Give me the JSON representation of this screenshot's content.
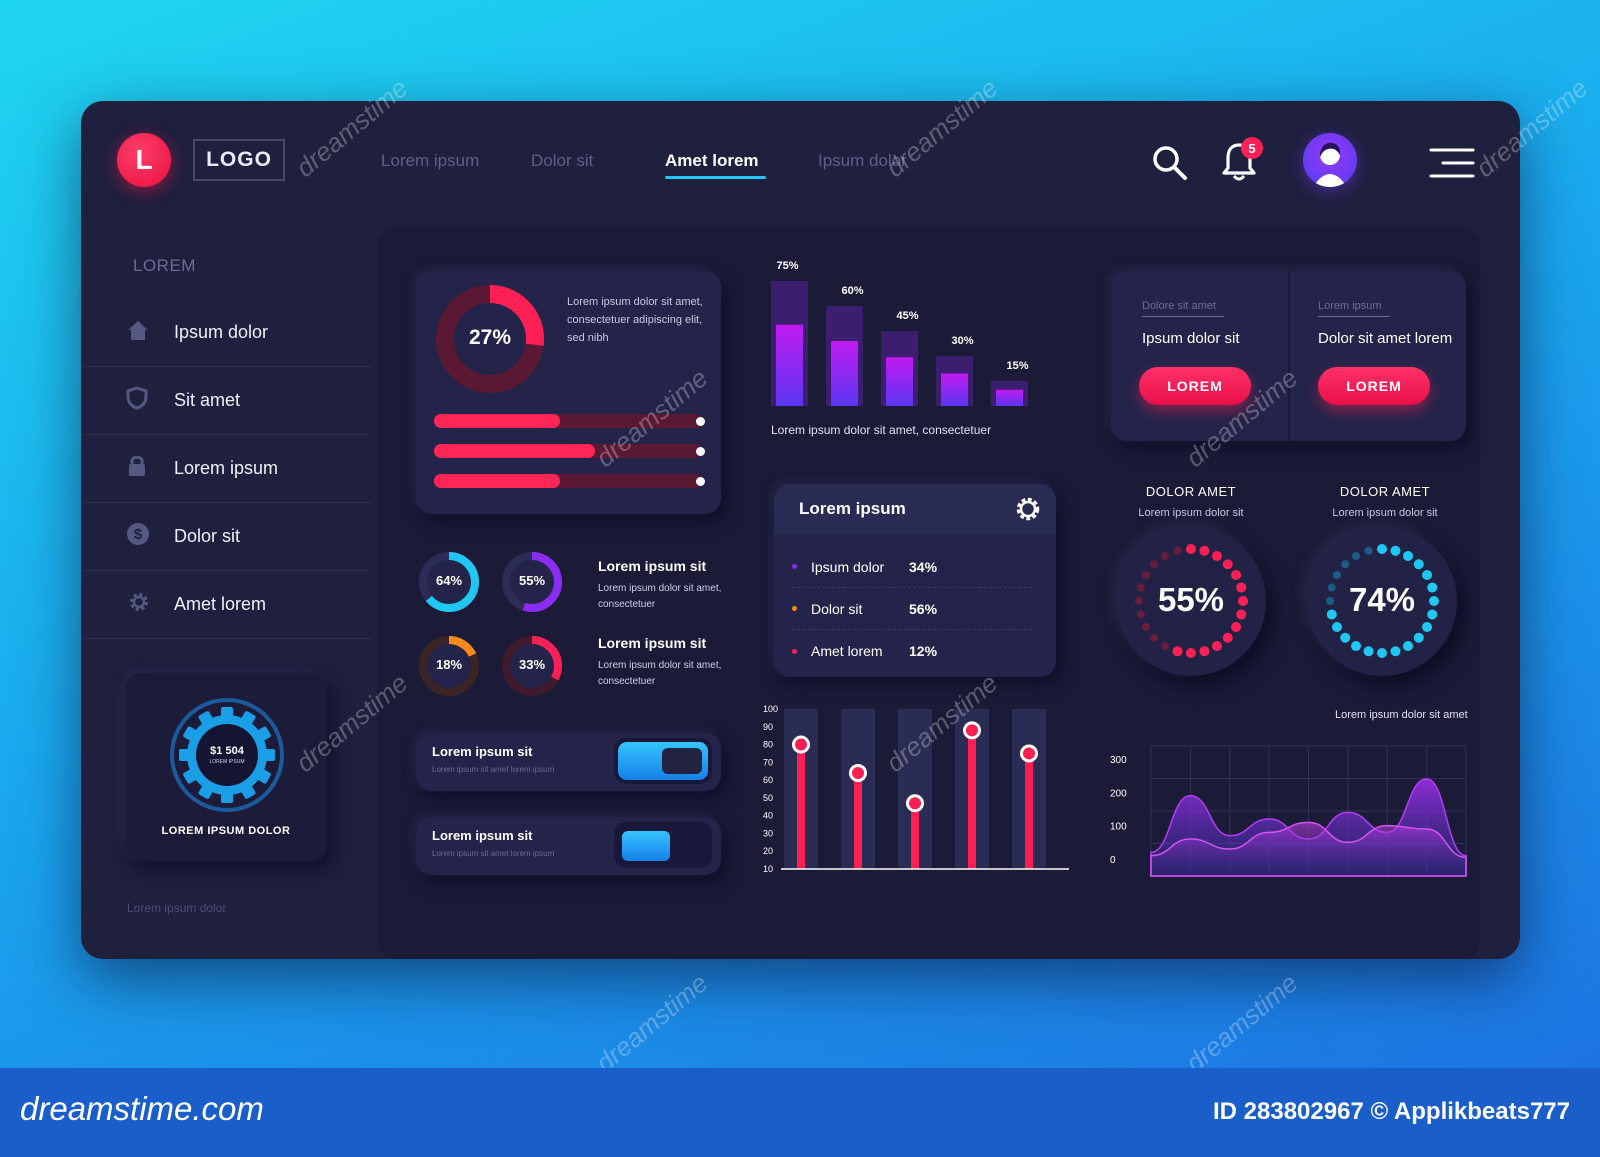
{
  "header": {
    "logo_letter": "L",
    "logo_text": "LOGO",
    "tabs": [
      {
        "label": "Lorem ipsum",
        "active": false
      },
      {
        "label": "Dolor sit",
        "active": false
      },
      {
        "label": "Amet lorem",
        "active": true
      },
      {
        "label": "Ipsum dolor",
        "active": false
      }
    ],
    "notification_count": "5",
    "icons": [
      "search-icon",
      "bell-icon",
      "avatar",
      "hamburger-menu-icon"
    ]
  },
  "sidebar": {
    "heading": "LOREM",
    "items": [
      {
        "label": "Ipsum dolor",
        "icon": "home-icon"
      },
      {
        "label": "Sit amet",
        "icon": "shield-icon"
      },
      {
        "label": "Lorem ipsum",
        "icon": "lock-icon"
      },
      {
        "label": "Dolor sit",
        "icon": "dollar-icon"
      },
      {
        "label": "Amet lorem",
        "icon": "gear-icon"
      }
    ],
    "widget": {
      "amount": "$1 504",
      "sub": "LOREM IPSUM",
      "caption": "LOREM IPSUM DOLOR"
    },
    "footer_text": "Lorem ipsum dolor"
  },
  "progress_card": {
    "donut_value": "27%",
    "donut_fraction": 0.27,
    "text": "Lorem ipsum dolor sit amet, consectetuer adipiscing elit, sed nibh",
    "bars": [
      0.47,
      0.6,
      0.47
    ]
  },
  "mini_donuts": [
    {
      "label": "64%",
      "value": 0.64,
      "color": "#1fc8f2"
    },
    {
      "label": "55%",
      "value": 0.55,
      "color": "#8b2cf5"
    },
    {
      "label": "18%",
      "value": 0.18,
      "color": "#ff8a1c"
    },
    {
      "label": "33%",
      "value": 0.33,
      "color": "#ff2155"
    }
  ],
  "mini_texts": [
    {
      "title": "Lorem ipsum sit",
      "body": "Lorem ipsum dolor sit amet, consectetuer"
    },
    {
      "title": "Lorem ipsum sit",
      "body": "Lorem ipsum dolor sit amet, consectetuer"
    }
  ],
  "toggles": [
    {
      "title": "Lorem ipsum sit",
      "body": "Lorem ipsum sit amet lorem ipsum"
    },
    {
      "title": "Lorem ipsum sit",
      "body": "Lorem ipsum sit amet lorem ipsum"
    }
  ],
  "bar_chart": {
    "caption": "Lorem ipsum dolor sit amet, consectetuer",
    "chart_data": {
      "type": "bar",
      "labels": [
        "75%",
        "60%",
        "45%",
        "30%",
        "15%"
      ],
      "values": [
        75,
        60,
        45,
        30,
        15
      ]
    }
  },
  "list_card": {
    "title": "Lorem ipsum",
    "rows": [
      {
        "label": "Ipsum dolor",
        "value": "34%",
        "dot": "#8b2cf5"
      },
      {
        "label": "Dolor sit",
        "value": "56%",
        "dot": "#ff8a1c"
      },
      {
        "label": "Amet lorem",
        "value": "12%",
        "dot": "#ff2155"
      }
    ]
  },
  "lollipop_chart": {
    "y_ticks": [
      "100",
      "90",
      "80",
      "70",
      "60",
      "50",
      "40",
      "30",
      "20",
      "10"
    ],
    "chart_data": {
      "type": "bar",
      "values": [
        80,
        64,
        47,
        88,
        75
      ],
      "ylim": [
        10,
        100
      ]
    }
  },
  "cta_cards": [
    {
      "label": "Dolore sit amet",
      "title": "Ipsum dolor sit",
      "button": "LOREM"
    },
    {
      "label": "Lorem ipsum",
      "title": "Dolor sit amet lorem",
      "button": "LOREM"
    }
  ],
  "gauges": [
    {
      "heading": "DOLOR AMET",
      "sub": "Lorem ipsum dolor sit",
      "value": "55%",
      "fraction": 0.55,
      "color": "#ff2155"
    },
    {
      "heading": "DOLOR AMET",
      "sub": "Lorem ipsum dolor sit",
      "value": "74%",
      "fraction": 0.74,
      "color": "#1fc8f2"
    }
  ],
  "area_chart": {
    "caption": "Lorem ipsum dolor sit amet",
    "y_ticks": [
      "300",
      "200",
      "100",
      "0"
    ],
    "chart_data": {
      "type": "area",
      "series": [
        {
          "values": [
            20,
            190,
            70,
            120,
            60,
            140,
            80,
            240,
            10
          ]
        },
        {
          "values": [
            10,
            60,
            30,
            80,
            110,
            50,
            100,
            90,
            5
          ]
        }
      ],
      "ylim": [
        0,
        300
      ]
    }
  },
  "branding": {
    "site": "dreamstime.com",
    "watermark": "dreamstime",
    "stock_id": "ID 283802967 © Applikbeats777"
  },
  "colors": {
    "panel": "#1f1f3e",
    "accent_pink": "#ff2155",
    "accent_cyan": "#1fc8f2",
    "accent_purple": "#8b2cf5"
  }
}
